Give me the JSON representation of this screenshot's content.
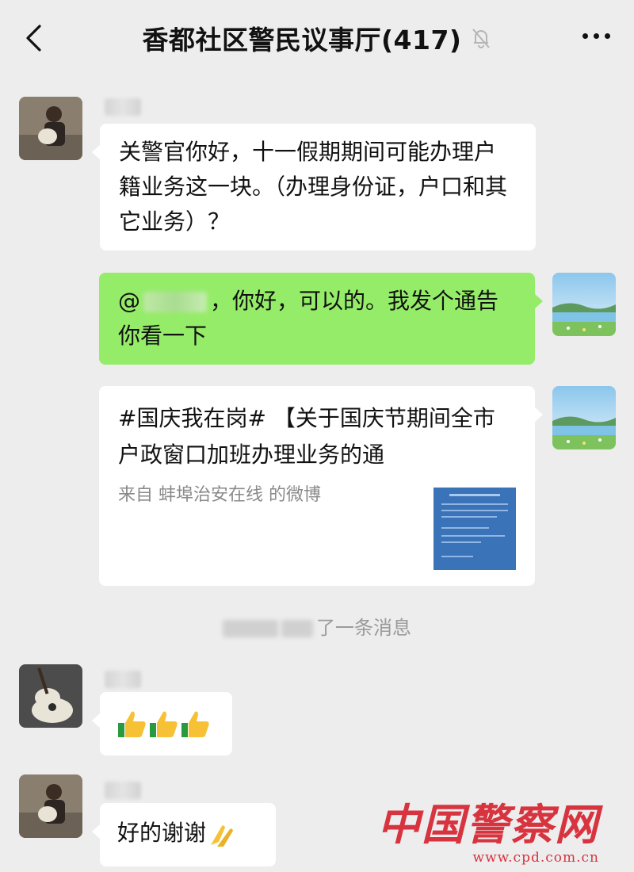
{
  "header": {
    "title": "香都社区警民议事厅(417)",
    "back_icon": "chevron-left-icon",
    "mute_icon": "bell-slash-icon",
    "more_icon": "more-dots-icon"
  },
  "messages": [
    {
      "side": "left",
      "type": "text",
      "text": "关警官你好，十一假期期间可能办理户籍业务这一块。（办理身份证，户口和其它业务）？"
    },
    {
      "side": "right",
      "type": "text",
      "prefix": "@",
      "text": "，你好，可以的。我发个通告你看一下"
    },
    {
      "side": "right",
      "type": "link-card",
      "title": "#国庆我在岗# 【关于国庆节期间全市户政窗口加班办理业务的通",
      "source": "来自 蚌埠治安在线 的微博"
    },
    {
      "side": "center",
      "type": "system",
      "text": "了一条消息"
    },
    {
      "side": "left",
      "type": "emoji",
      "emoji": "👍👍👍"
    },
    {
      "side": "left",
      "type": "text",
      "text": "好的谢谢",
      "emoji": "🙏"
    }
  ],
  "watermark": {
    "logo": "中国警察网",
    "url": "www.cpd.com.cn"
  },
  "colors": {
    "background": "#ededed",
    "green_bubble": "#95ec69",
    "white_bubble": "#ffffff",
    "watermark": "#d8343f"
  }
}
